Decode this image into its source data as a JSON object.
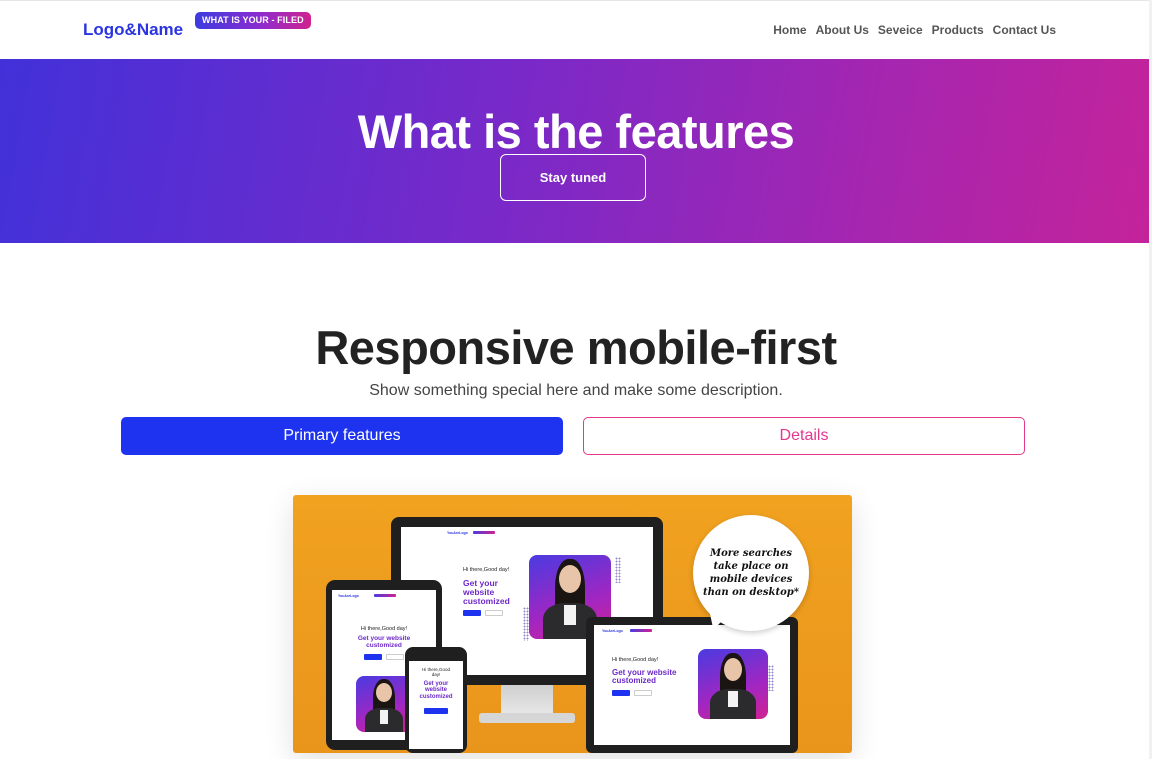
{
  "navbar": {
    "brand": "Logo&Name",
    "badge": "WHAT IS YOUR - FILED",
    "links": [
      "Home",
      "About Us",
      "Seveice",
      "Products",
      "Contact Us"
    ]
  },
  "hero": {
    "title": "What is the features",
    "button": "Stay tuned"
  },
  "section": {
    "title": "Responsive mobile-first",
    "description": "Show something special here and make some description.",
    "primary_button": "Primary features",
    "secondary_button": "Details"
  },
  "showcase": {
    "bubble_text": "More searches take place on mobile devices than on desktop*",
    "mockup_greeting": "Hi there,Good day!",
    "mockup_heading": "Get your website customized",
    "mockup_heading_tablet": "Get your website customized",
    "mockup_phone_greeting": "Hi there,Good day!",
    "mockup_phone_heading": "Get your website customized",
    "mockup_brand": "YouAreLogo"
  },
  "colors": {
    "accent": "#1e33f0",
    "pink": "#e2388e",
    "hero_start": "#4231d9",
    "hero_end": "#c4239a",
    "showcase_bg": "#f1a21f"
  }
}
